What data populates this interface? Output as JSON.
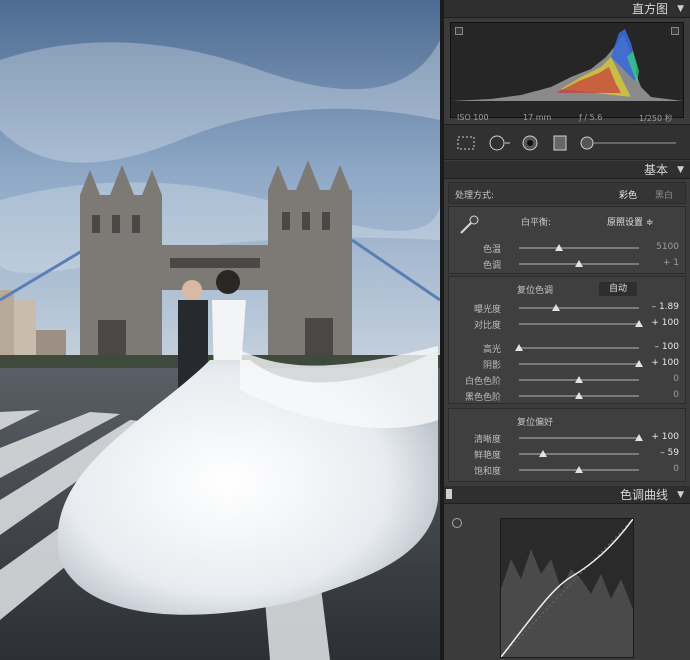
{
  "histogram": {
    "title": "直方图",
    "iso": "ISO 100",
    "focal": "17 mm",
    "aperture": "ƒ / 5.6",
    "shutter": "1/250 秒"
  },
  "basic": {
    "title": "基本",
    "treatment_label": "处理方式:",
    "treatment_color": "彩色",
    "treatment_bw": "黑白",
    "wb_label": "白平衡:",
    "wb_value": "原照设置 ≑",
    "tone_label": "复位色调",
    "auto_label": "自动",
    "presence_label": "复位偏好",
    "sliders": {
      "temp": {
        "label": "色温",
        "value": "5100",
        "level": 0.33
      },
      "tint": {
        "label": "色调",
        "value": "+ 1",
        "level": 0.5
      },
      "exposure": {
        "label": "曝光度",
        "value": "– 1.89",
        "level": 0.31
      },
      "contrast": {
        "label": "对比度",
        "value": "+ 100",
        "level": 1.0
      },
      "highlights": {
        "label": "高光",
        "value": "– 100",
        "level": 0.0
      },
      "shadows": {
        "label": "阴影",
        "value": "+ 100",
        "level": 1.0
      },
      "whites": {
        "label": "白色色阶",
        "value": "0",
        "level": 0.5
      },
      "blacks": {
        "label": "黑色色阶",
        "value": "0",
        "level": 0.5
      },
      "clarity": {
        "label": "清晰度",
        "value": "+ 100",
        "level": 1.0
      },
      "vibrance": {
        "label": "鲜艳度",
        "value": "– 59",
        "level": 0.2
      },
      "saturation": {
        "label": "饱和度",
        "value": "0",
        "level": 0.5
      }
    }
  },
  "tone_curve": {
    "title": "色调曲线"
  },
  "colors": {
    "panel_bg": "#3b3b3b",
    "header_bg": "#2f2f2f",
    "accent_text": "#e6e6e6"
  }
}
